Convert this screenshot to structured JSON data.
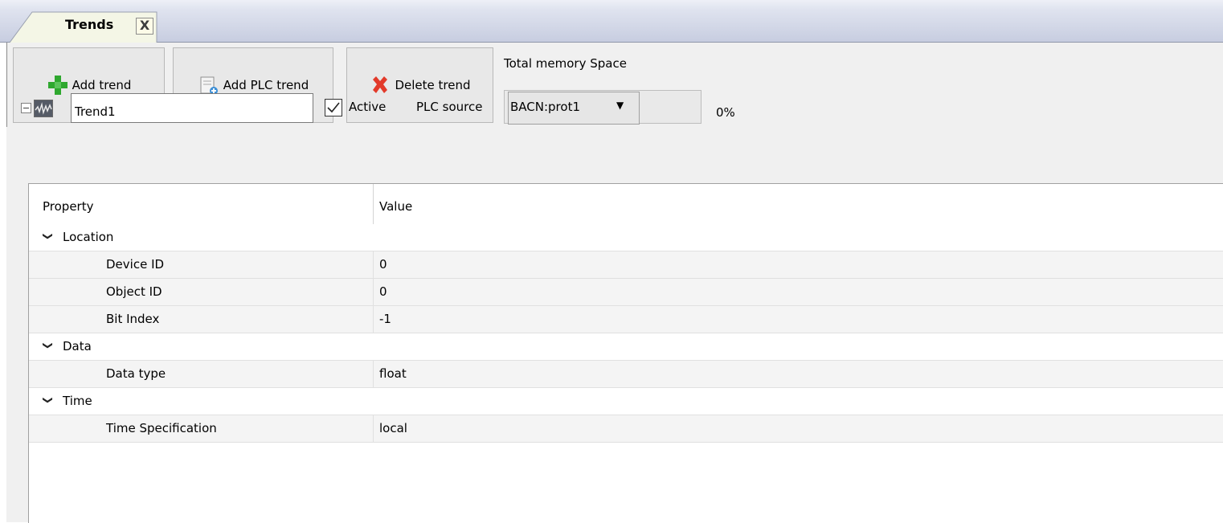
{
  "tab": {
    "label": "Trends",
    "close": "X"
  },
  "toolbar": {
    "add_trend": "Add trend",
    "add_plc_trend": "Add PLC trend",
    "delete_trend": "Delete trend",
    "memory_title": "Total memory Space",
    "memory_percent": "0%",
    "memory_fraction": 0
  },
  "trend": {
    "name": "Trend1",
    "active_checked": true,
    "active_label": "Active",
    "plc_source_label": "PLC source",
    "plc_source_value": "BACN:prot1"
  },
  "grid": {
    "header_property": "Property",
    "header_value": "Value",
    "categories": [
      {
        "label": "Location",
        "rows": [
          {
            "property": "Device ID",
            "value": "0"
          },
          {
            "property": "Object ID",
            "value": "0"
          },
          {
            "property": "Bit Index",
            "value": "-1"
          }
        ]
      },
      {
        "label": "Data",
        "rows": [
          {
            "property": "Data type",
            "value": "float"
          }
        ]
      },
      {
        "label": "Time",
        "rows": [
          {
            "property": "Time Specification",
            "value": "local"
          }
        ]
      }
    ]
  },
  "colors": {
    "selection_bar": "#3c9fe8",
    "add_icon": "#2fa82f",
    "delete_icon": "#e23a2a"
  }
}
